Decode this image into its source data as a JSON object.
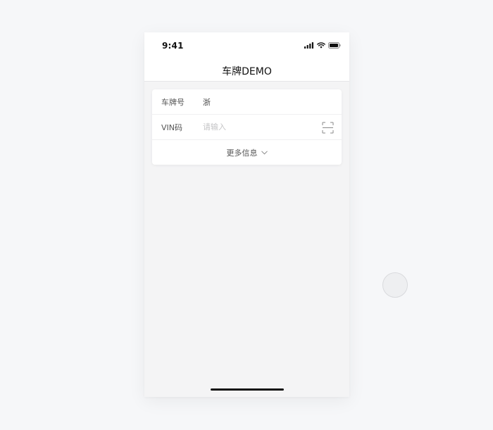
{
  "status_bar": {
    "time": "9:41"
  },
  "nav": {
    "title": "车牌DEMO"
  },
  "form": {
    "plate": {
      "label": "车牌号",
      "value": "浙"
    },
    "vin": {
      "label": "VIN码",
      "placeholder": "请输入",
      "value": ""
    },
    "more": {
      "label": "更多信息"
    }
  },
  "icons": {
    "signal": "cellular-signal-icon",
    "wifi": "wifi-icon",
    "battery": "battery-icon",
    "scan": "scan-icon",
    "chevron": "chevron-down-icon"
  },
  "colors": {
    "page_background": "#f6f7f9",
    "screen_background": "#f4f4f5",
    "card_background": "#ffffff",
    "placeholder": "#c4c4c6",
    "home_indicator": "#111111"
  }
}
